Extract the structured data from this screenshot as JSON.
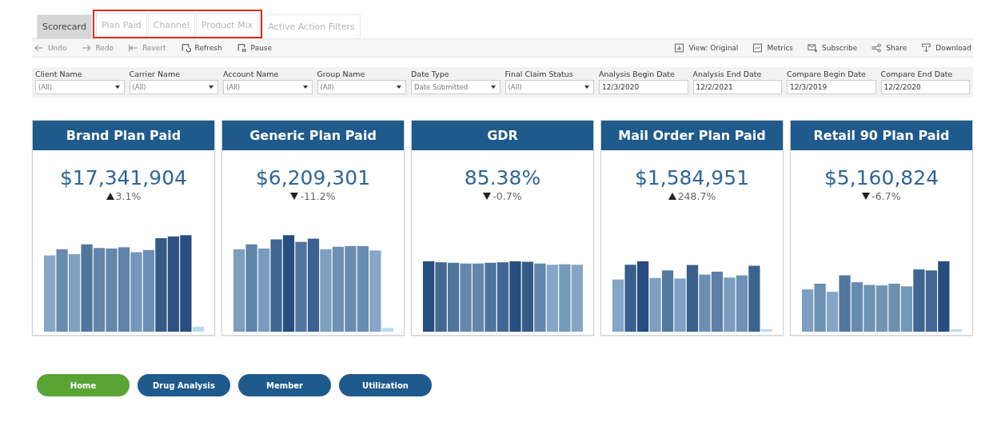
{
  "tabs": [
    {
      "label": "Scorecard",
      "selected": true,
      "highlighted": false
    },
    {
      "label": "Plan Paid",
      "selected": false,
      "highlighted": true
    },
    {
      "label": "Channel",
      "selected": false,
      "highlighted": true
    },
    {
      "label": "Product Mix",
      "selected": false,
      "highlighted": true
    },
    {
      "label": "Active Action Filters",
      "selected": false,
      "highlighted": false
    }
  ],
  "toolbar": {
    "left": [
      {
        "kind": "undo",
        "label": "Undo",
        "disabled": true
      },
      {
        "kind": "redo",
        "label": "Redo",
        "disabled": true
      },
      {
        "kind": "revert",
        "label": "Revert",
        "disabled": true
      },
      {
        "kind": "refresh",
        "label": "Refresh",
        "disabled": false
      },
      {
        "kind": "pause",
        "label": "Pause",
        "disabled": false
      }
    ],
    "right": [
      {
        "kind": "view",
        "label": "View: Original"
      },
      {
        "kind": "metrics",
        "label": "Metrics"
      },
      {
        "kind": "subscribe",
        "label": "Subscribe"
      },
      {
        "kind": "share",
        "label": "Share"
      },
      {
        "kind": "download",
        "label": "Download"
      }
    ]
  },
  "filters": [
    {
      "label": "Client Name",
      "kind": "dropdown",
      "value": "(All)"
    },
    {
      "label": "Carrier Name",
      "kind": "dropdown",
      "value": "(All)"
    },
    {
      "label": "Account Name",
      "kind": "dropdown",
      "value": "(All)"
    },
    {
      "label": "Group Name",
      "kind": "dropdown",
      "value": "(All)"
    },
    {
      "label": "Date Type",
      "kind": "dropdown",
      "value": "Date Submitted"
    },
    {
      "label": "Final Claim Status",
      "kind": "dropdown",
      "value": "(All)"
    },
    {
      "label": "Analysis Begin Date",
      "kind": "date",
      "value": "12/3/2020"
    },
    {
      "label": "Analysis End Date",
      "kind": "date",
      "value": "12/2/2021"
    },
    {
      "label": "Compare Begin Date",
      "kind": "date",
      "value": "12/3/2019"
    },
    {
      "label": "Compare End Date",
      "kind": "date",
      "value": "12/2/2020"
    }
  ],
  "cards": [
    {
      "title": "Brand Plan Paid",
      "value": "$17,341,904",
      "rising": true,
      "change": "3.1%"
    },
    {
      "title": "Generic Plan Paid",
      "value": "$6,209,301",
      "rising": false,
      "change": "-11.2%"
    },
    {
      "title": "GDR",
      "value": "85.38%",
      "rising": false,
      "change": "-0.7%"
    },
    {
      "title": "Mail Order Plan Paid",
      "value": "$1,584,951",
      "rising": true,
      "change": "248.7%"
    },
    {
      "title": "Retail 90 Plan Paid",
      "value": "$5,160,824",
      "rising": false,
      "change": "-6.7%"
    }
  ],
  "nav": [
    {
      "label": "Home",
      "selected": true
    },
    {
      "label": "Drug Analysis",
      "selected": false
    },
    {
      "label": "Member",
      "selected": false
    },
    {
      "label": "Utilization",
      "selected": false
    }
  ]
}
